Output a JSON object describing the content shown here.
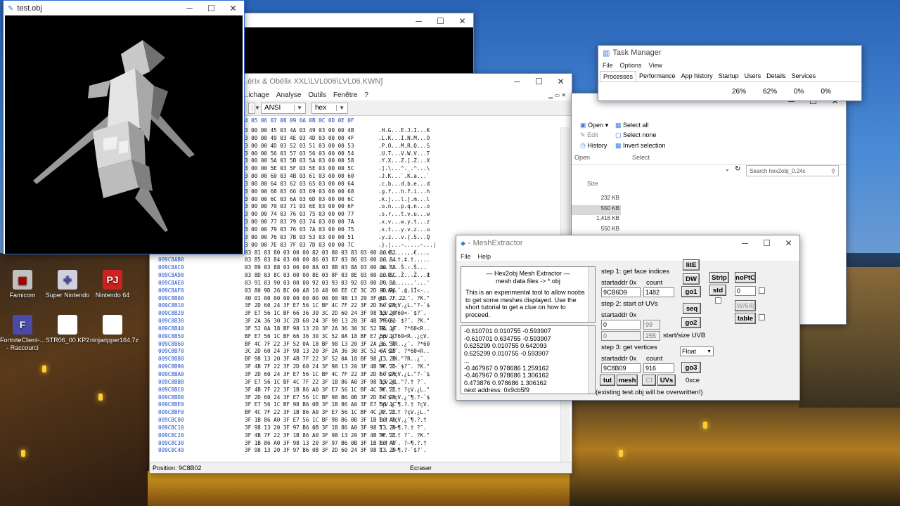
{
  "desktop": {
    "icons": [
      {
        "label": "Famicom",
        "color": "#c0c0c0"
      },
      {
        "label": "Super Nintendo",
        "color": "#8a8ac8"
      },
      {
        "label": "Nintendo 64",
        "color": "#d02020"
      },
      {
        "label": "FortniteClient-... - Raccourci",
        "color": "#4a4aa8"
      },
      {
        "label": "STR06_00.KP2",
        "color": "#ffffff"
      },
      {
        "label": "ninjaripper164.7z",
        "color": "#ffffff"
      }
    ]
  },
  "obj_window": {
    "title": "test.obj"
  },
  "hex_window": {
    "title": "...érix & Obélix XXL\\LVL006\\LVL06.KWN]",
    "menu": [
      "...ichage",
      "Analyse",
      "Outils",
      "Fenêtre",
      "?"
    ],
    "encoding": "ANSI",
    "mode": "hex",
    "header_bytes": "4 05 06 07 08 09 0A 0B 0C 0D 0E 0F",
    "rows": [
      {
        "addr": "",
        "bytes": "3 00 00 45 03 4A 03 49 03 00 00 4B",
        "ascii": ".H.G...E.J.I...K"
      },
      {
        "addr": "",
        "bytes": "3 00 00 49 03 4E 03 4D 03 00 00 4F",
        "ascii": ".L.K...I.N.M...O"
      },
      {
        "addr": "",
        "bytes": "3 00 00 4D 03 52 03 51 03 00 00 53",
        "ascii": ".P.O...M.R.Q...S"
      },
      {
        "addr": "",
        "bytes": "3 00 00 56 03 57 03 56 03 00 00 54",
        "ascii": ".U.T...V.W.V...T"
      },
      {
        "addr": "",
        "bytes": "3 00 00 5A 03 5B 03 5A 03 00 00 58",
        "ascii": ".Y.X...Z.[.Z...X"
      },
      {
        "addr": "",
        "bytes": "3 00 00 5E 03 5F 03 5E 03 00 00 5C",
        "ascii": ".].\\...^._.^...\\"
      },
      {
        "addr": "",
        "bytes": "3 00 00 60 03 4B 03 61 03 00 00 60",
        "ascii": ".J.K...`.K.a...`"
      },
      {
        "addr": "",
        "bytes": "3 00 00 64 03 62 03 65 03 00 00 64",
        "ascii": ".c.b...d.b.e...d"
      },
      {
        "addr": "",
        "bytes": "3 00 00 68 03 66 03 69 03 00 00 68",
        "ascii": ".g.f...h.f.i...h"
      },
      {
        "addr": "",
        "bytes": "3 00 00 6C 03 6A 03 6D 03 00 00 6C",
        "ascii": ".k.j...l.j.m...l"
      },
      {
        "addr": "",
        "bytes": "3 00 00 70 03 71 03 6E 03 00 00 6F",
        "ascii": ".o.n...p.q.n...o"
      },
      {
        "addr": "",
        "bytes": "3 00 00 74 03 76 03 75 03 00 00 77",
        "ascii": ".s.r...t.v.u...w"
      },
      {
        "addr": "",
        "bytes": "3 00 00 77 03 79 03 74 03 00 00 7A",
        "ascii": ".x.v...w.y.t...z"
      },
      {
        "addr": "",
        "bytes": "3 00 00 79 03 76 03 7A 03 00 00 75",
        "ascii": ".s.t...y.v.z...u"
      },
      {
        "addr": "",
        "bytes": "3 00 00 76 03 7B 03 53 03 00 00 51",
        "ascii": ".y.z...v.{.S...Q"
      },
      {
        "addr": "",
        "bytes": "3 00 00 7E 03 7F 03 7D 03 00 00 7C",
        "ascii": ".}.|...~.....~...|"
      },
      {
        "addr": "009C8AA0",
        "bytes": "03 81 03 80 03 00 00 82 03 80 03 83 03 00 00 82",
        "ascii": "...€.....,.€...,"
      },
      {
        "addr": "009C8AB0",
        "bytes": "03 85 03 84 03 00 00 86 03 87 03 86 03 00 00 84",
        "ascii": "......†.‡.†....."
      },
      {
        "addr": "009C8AC0",
        "bytes": "03 89 03 88 03 00 00 8A 03 8B 03 8A 03 00 00 88",
        "ascii": ".‰.ˆ...Š.‹.Š..."
      },
      {
        "addr": "009C8AD0",
        "bytes": "03 8D 03 8C 03 00 00 8E 03 8F 03 8E 03 00 00 8C",
        "ascii": "...Œ...Ž...Ž...Œ"
      },
      {
        "addr": "009C8AE0",
        "bytes": "03 91 03 90 03 00 00 92 03 93 03 92 03 00 00 90",
        "ascii": ".'.........'...'"
      },
      {
        "addr": "009C8AF0",
        "bytes": "03 80 9D 26 BC 00 A8 10 40 00 EE CE 3C 2D 90 96",
        "ascii": ".€.&¼.¨.@.îÎ<-.."
      },
      {
        "addr": "009C8B00",
        "bytes": "40 01 00 00 00 00 00 00 00 00 98 13 20 3F 4B 7F 22",
        "ascii": "@........˜. ?K.\""
      },
      {
        "addr": "009C8B10",
        "bytes": "3F 2D 60 24 3F E7 56 1C BF 4C 7F 22 3F 2D 60 24",
        "ascii": "?-`$?çV.¿L.\"?-`$"
      },
      {
        "addr": "009C8B20",
        "bytes": "3F E7 56 1C BF 66 36 30 3C 2D 60 24 3F 98 13 20",
        "ascii": "?çV.¿f60<-`$?˜. "
      },
      {
        "addr": "009C8B30",
        "bytes": "3F 2A 36 30 3C 2D 60 24 3F 98 13 20 3F 4B 7F 22",
        "ascii": "?*60<-`$?˜. ?K.\""
      },
      {
        "addr": "009C8B40",
        "bytes": "3F 52 0A 18 BF 98 13 20 3F 2A 36 30 3C 52 0A 18",
        "ascii": "?R..¿˜. ?*60<R.."
      },
      {
        "addr": "009C8B50",
        "bytes": "BF E7 56 1C BF 66 36 30 3C 52 0A 18 BF E7 56 1C",
        "ascii": "¿çV.¿f60<R..¿çV."
      },
      {
        "addr": "009C8B60",
        "bytes": "BF 4C 7F 22 3F 52 0A 18 BF 98 13 20 3F 2A 36 30",
        "ascii": "¿L.\"?R..¿˜. ?*60"
      },
      {
        "addr": "009C8B70",
        "bytes": "3C 2D 60 24 3F 98 13 20 3F 2A 36 30 3C 52 0A 18",
        "ascii": "<-`$?˜. ?*60<R.."
      },
      {
        "addr": "009C8B80",
        "bytes": "BF 98 13 20 3F 4B 7F 22 3F 52 0A 18 BF 98 13 20",
        "ascii": "¿˜. ?K.\"?R..¿˜. "
      },
      {
        "addr": "009C8B90",
        "bytes": "3F 4B 7F 22 3F 2D 60 24 3F 98 13 20 3F 4B 7F 22",
        "ascii": "?K.\"?-`$?˜. ?K.\""
      },
      {
        "addr": "009C8BA0",
        "bytes": "3F 2D 60 24 3F E7 56 1C BF 4C 7F 22 3F 2D 60 24",
        "ascii": "?-`$?çV.¿L.\"?-`$"
      },
      {
        "addr": "009C8BB0",
        "bytes": "3F E7 56 1C BF 4C 7F 22 3F 1B 86 A0 3F 98 13 20",
        "ascii": "?çV.¿L.\"?.† ?˜. "
      },
      {
        "addr": "009C8BC0",
        "bytes": "3F 4B 7F 22 3F 1B 86 A0 3F E7 56 1C BF 4C 7F 22",
        "ascii": "?K.\"?.† ?çV.¿L.\""
      },
      {
        "addr": "009C8BD0",
        "bytes": "3F 2D 60 24 3F E7 56 1C BF 98 B6 0B 3F 2D 60 24",
        "ascii": "?-`$?çV.¿˜¶.?-`$"
      },
      {
        "addr": "009C8BE0",
        "bytes": "3F E7 56 1C BF 98 B6 0B 3F 1B 86 A0 3F E7 56 1C",
        "ascii": "?çV.¿˜¶.?.† ?çV."
      },
      {
        "addr": "009C8BF0",
        "bytes": "BF 4C 7F 22 3F 1B 86 A0 3F E7 56 1C BF 4C 7F 22",
        "ascii": "¿L.\"?.† ?çV.¿L.\""
      },
      {
        "addr": "009C8C00",
        "bytes": "3F 1B 86 A0 3F E7 56 1C BF 98 B6 0B 3F 1B 86 A0",
        "ascii": "?.† ?çV.¿˜¶.?.† "
      },
      {
        "addr": "009C8C10",
        "bytes": "3F 98 13 20 3F 97 B6 0B 3F 1B 86 A0 3F 98 13 20",
        "ascii": "?˜. ?—¶.?.† ?˜. "
      },
      {
        "addr": "009C8C20",
        "bytes": "3F 4B 7F 22 3F 1B 86 A0 3F 98 13 20 3F 4B 7F 22",
        "ascii": "?K.\"?.† ?˜. ?K.\""
      },
      {
        "addr": "009C8C30",
        "bytes": "3F 1B 86 A0 3F 98 13 20 3F 97 B6 0B 3F 1B 86 A0",
        "ascii": "?.† ?˜. ?—¶.?.† "
      },
      {
        "addr": "009C8C40",
        "bytes": "3F 98 13 20 3F 97 B6 0B 3F 2D 60 24 3F 98 13 20",
        "ascii": "?˜. ?—¶.?-`$?˜. "
      }
    ],
    "status_position": "Position: 9C8B02",
    "status_mode": "Ecraser"
  },
  "task_manager": {
    "title": "Task Manager",
    "menu": [
      "File",
      "Options",
      "View"
    ],
    "tabs": [
      "Processes",
      "Performance",
      "App history",
      "Startup",
      "Users",
      "Details",
      "Services"
    ],
    "stats": [
      "26%",
      "62%",
      "0%",
      "0%"
    ]
  },
  "explorer": {
    "ribbon": {
      "open": "Open",
      "edit": "Edit",
      "history": "History",
      "select_all": "Select all",
      "select_none": "Select none",
      "invert_selection": "Invert selection",
      "group_open": "Open",
      "group_select": "Select"
    },
    "search_placeholder": "Search hex2obj_0.24c",
    "size_header": "Size",
    "sizes": [
      "232 KB",
      "550 KB",
      "1,416 KB",
      "550 KB"
    ]
  },
  "mesh_extractor": {
    "title": "- MeshExtractor",
    "menu": [
      "File",
      "Help"
    ],
    "info_header_1": "Hex2obj Mesh Extractor",
    "info_header_2": "mesh data files -> *.obj",
    "info_text": "This is an experimental tool to allow noobs to get some meshes displayed. Use the short tutorial to get a clue on how to proceed.",
    "output_lines": [
      "-0.610701 0.010755 -0.593907",
      "-0.610701 0.634755 -0.593907",
      "0.625299 0.010755 0.642093",
      "0.625299 0.010755 -0.593907",
      "...",
      "-0.467967 0.978686 1.259162",
      "-0.467967 0.978686 1.306162",
      "0.473876 0.978686 1.306162",
      "next address: 0x9cb5f9"
    ],
    "step1_label": "step 1: get face indices",
    "step2_label": "step 2: start of UVs",
    "step3_label": "step 3: get vertices",
    "startaddr_label": "startaddr 0x",
    "count_label": "count",
    "step1_startaddr": "9CB6D9",
    "step1_count": "1482",
    "step2_startaddr": "0",
    "step2_count": "99",
    "step2_uvb_start": "0",
    "step2_uvb_size": "255",
    "uvb_label": "start/size UVB",
    "step3_startaddr": "9C8B09",
    "step3_count": "916",
    "buttons": {
      "lite": "litE",
      "dw": "DW",
      "go1": "go1",
      "strip": "Strip",
      "std": "std",
      "noptc": "noPtC",
      "seq": "seq",
      "go2": "go2",
      "wf64": "W/64|",
      "table": "table",
      "go3": "go3",
      "tut": "tut",
      "mesh": "mesh",
      "cf": "Cf",
      "uvs": "UVs"
    },
    "noptc_value": "0",
    "float_select": "Float",
    "uv_offset": "0xce",
    "overwrite_note": "(existing test.obj will be overwritten!)"
  }
}
